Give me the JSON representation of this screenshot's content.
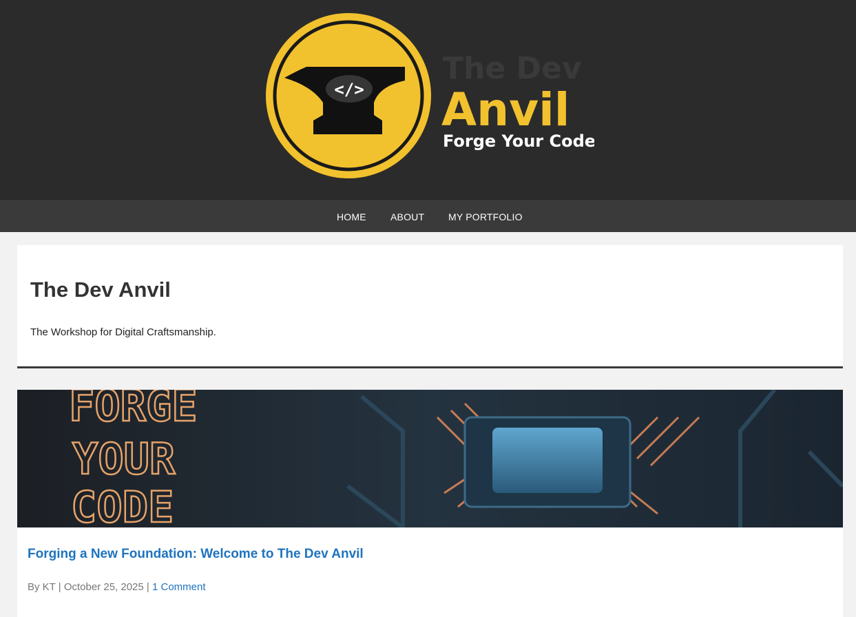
{
  "header": {
    "logo": {
      "brand_line1": "The Dev",
      "brand_line2": "Anvil",
      "slogan": "Forge Your Code.",
      "icon_glyph": "</>",
      "icon_name": "anvil-code-icon",
      "accent": "#f2c12e"
    }
  },
  "nav": {
    "items": [
      {
        "label": "HOME"
      },
      {
        "label": "ABOUT"
      },
      {
        "label": "MY PORTFOLIO"
      }
    ]
  },
  "site": {
    "title": "The Dev Anvil",
    "tagline": "The Workshop for Digital Craftsmanship."
  },
  "post": {
    "featured_image": {
      "overlay_lines": [
        "FORGE",
        "YOUR",
        "CODE"
      ],
      "subject": "circuit-board-chip"
    },
    "title": "Forging a New Foundation: Welcome to The Dev Anvil",
    "meta": {
      "by": "By KT",
      "sep1": "|",
      "date": "October 25, 2025",
      "sep2": "|",
      "comments": "1 Comment"
    }
  },
  "colors": {
    "header_bg": "#2b2b2b",
    "nav_bg": "#3a3a3a",
    "link": "#1e73be",
    "logo_yellow": "#f2c12e"
  }
}
